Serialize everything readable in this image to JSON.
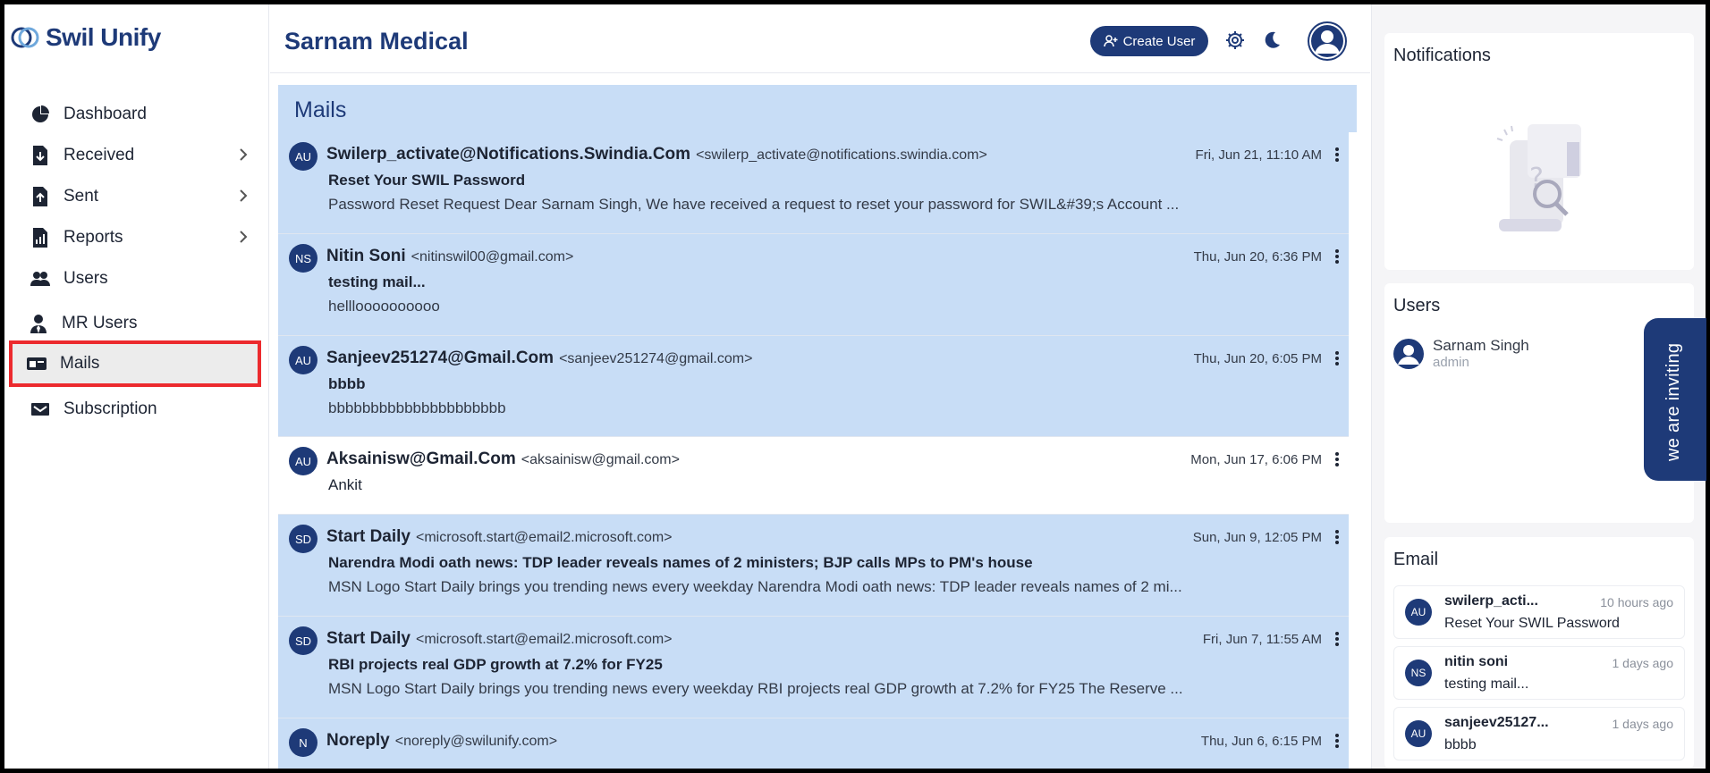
{
  "brand": {
    "name": "Swil Unify"
  },
  "sidebar": {
    "items": [
      {
        "label": "Dashboard",
        "icon": "pie-chart-icon"
      },
      {
        "label": "Received",
        "icon": "received-icon"
      },
      {
        "label": "Sent",
        "icon": "sent-icon"
      },
      {
        "label": "Reports",
        "icon": "reports-icon"
      },
      {
        "label": "Users",
        "icon": "users-icon"
      },
      {
        "label": "MR Users",
        "icon": "mr-user-icon"
      },
      {
        "label": "Mails",
        "icon": "mail-icon"
      },
      {
        "label": "Subscription",
        "icon": "subscription-icon"
      }
    ],
    "active": "Mails"
  },
  "header": {
    "title": "Sarnam Medical",
    "create_user_label": "Create User"
  },
  "mails": {
    "title": "Mails",
    "items": [
      {
        "initials": "AU",
        "sender": "Swilerp_activate@Notifications.Swindia.Com",
        "address": "<swilerp_activate@notifications.swindia.com>",
        "date": "Fri, Jun 21, 11:10 AM",
        "subject": "Reset Your SWIL Password",
        "preview": "Password Reset Request Dear Sarnam Singh, We have received a request to reset your password for SWIL&#39;s Account ...",
        "unread": true
      },
      {
        "initials": "NS",
        "sender": "Nitin Soni",
        "address": "<nitinswil00@gmail.com>",
        "date": "Thu, Jun 20, 6:36 PM",
        "subject": "testing mail...",
        "preview": "hellloooooooooo",
        "unread": true
      },
      {
        "initials": "AU",
        "sender": "Sanjeev251274@Gmail.Com",
        "address": "<sanjeev251274@gmail.com>",
        "date": "Thu, Jun 20, 6:05 PM",
        "subject": "bbbb",
        "preview": "bbbbbbbbbbbbbbbbbbbbb",
        "unread": true
      },
      {
        "initials": "AU",
        "sender": "Aksainisw@Gmail.Com",
        "address": "<aksainisw@gmail.com>",
        "date": "Mon, Jun 17, 6:06 PM",
        "subject": "Ankit",
        "preview": "",
        "unread": false
      },
      {
        "initials": "SD",
        "sender": "Start Daily",
        "address": "<microsoft.start@email2.microsoft.com>",
        "date": "Sun, Jun 9, 12:05 PM",
        "subject": "Narendra Modi oath news: TDP leader reveals names of 2 ministers; BJP calls MPs to PM's house",
        "preview": "MSN Logo Start Daily brings you trending news every weekday Narendra Modi oath news: TDP leader reveals names of 2 mi...",
        "unread": true
      },
      {
        "initials": "SD",
        "sender": "Start Daily",
        "address": "<microsoft.start@email2.microsoft.com>",
        "date": "Fri, Jun 7, 11:55 AM",
        "subject": "RBI projects real GDP growth at 7.2% for FY25",
        "preview": "MSN Logo Start Daily brings you trending news every weekday RBI projects real GDP growth at 7.2% for FY25 The Reserve ...",
        "unread": true
      },
      {
        "initials": "N",
        "sender": "Noreply",
        "address": "<noreply@swilunify.com>",
        "date": "Thu, Jun 6, 6:15 PM",
        "subject": "",
        "preview": "",
        "unread": true
      }
    ]
  },
  "right": {
    "notifications_title": "Notifications",
    "users_title": "Users",
    "user": {
      "name": "Sarnam Singh",
      "role": "admin"
    },
    "email_title": "Email",
    "emails": [
      {
        "initials": "AU",
        "from": "swilerp_acti...",
        "when": "10 hours ago",
        "subject": "Reset Your SWIL Password"
      },
      {
        "initials": "NS",
        "from": "nitin soni",
        "when": "1 days ago",
        "subject": "testing mail..."
      },
      {
        "initials": "AU",
        "from": "sanjeev25127...",
        "when": "1 days ago",
        "subject": "bbbb"
      }
    ],
    "invite_label": "we are inviting"
  },
  "colors": {
    "brand": "#1e3a78",
    "unread_bg": "#c8ddf6",
    "active_outline": "#ec2a2e"
  }
}
